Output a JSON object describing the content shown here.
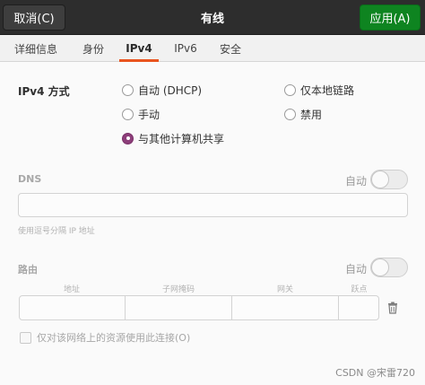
{
  "header": {
    "cancel_label": "取消(C)",
    "title": "有线",
    "apply_label": "应用(A)"
  },
  "tabs": [
    {
      "label": "详细信息"
    },
    {
      "label": "身份"
    },
    {
      "label": "IPv4",
      "active": true
    },
    {
      "label": "IPv6"
    },
    {
      "label": "安全"
    }
  ],
  "ipv4": {
    "method_label": "IPv4 方式",
    "options": [
      {
        "label": "自动 (DHCP)",
        "checked": false
      },
      {
        "label": "仅本地链路",
        "checked": false
      },
      {
        "label": "手动",
        "checked": false
      },
      {
        "label": "禁用",
        "checked": false
      },
      {
        "label": "与其他计算机共享",
        "checked": true
      }
    ]
  },
  "dns": {
    "heading": "DNS",
    "auto_label": "自动",
    "auto_on": false,
    "value": "",
    "hint": "使用逗号分隔 IP 地址"
  },
  "routes": {
    "heading": "路由",
    "auto_label": "自动",
    "auto_on": false,
    "columns": [
      "地址",
      "子网掩码",
      "网关",
      "跃点"
    ],
    "only_local_label": "仅对该网络上的资源使用此连接(O)",
    "only_local_checked": false
  },
  "watermark": "CSDN @宋雷720",
  "colors": {
    "header_bg": "#2d2d2d",
    "apply_green": "#0e8420",
    "tab_accent": "#e95420",
    "radio_checked": "#8d3e7a"
  }
}
